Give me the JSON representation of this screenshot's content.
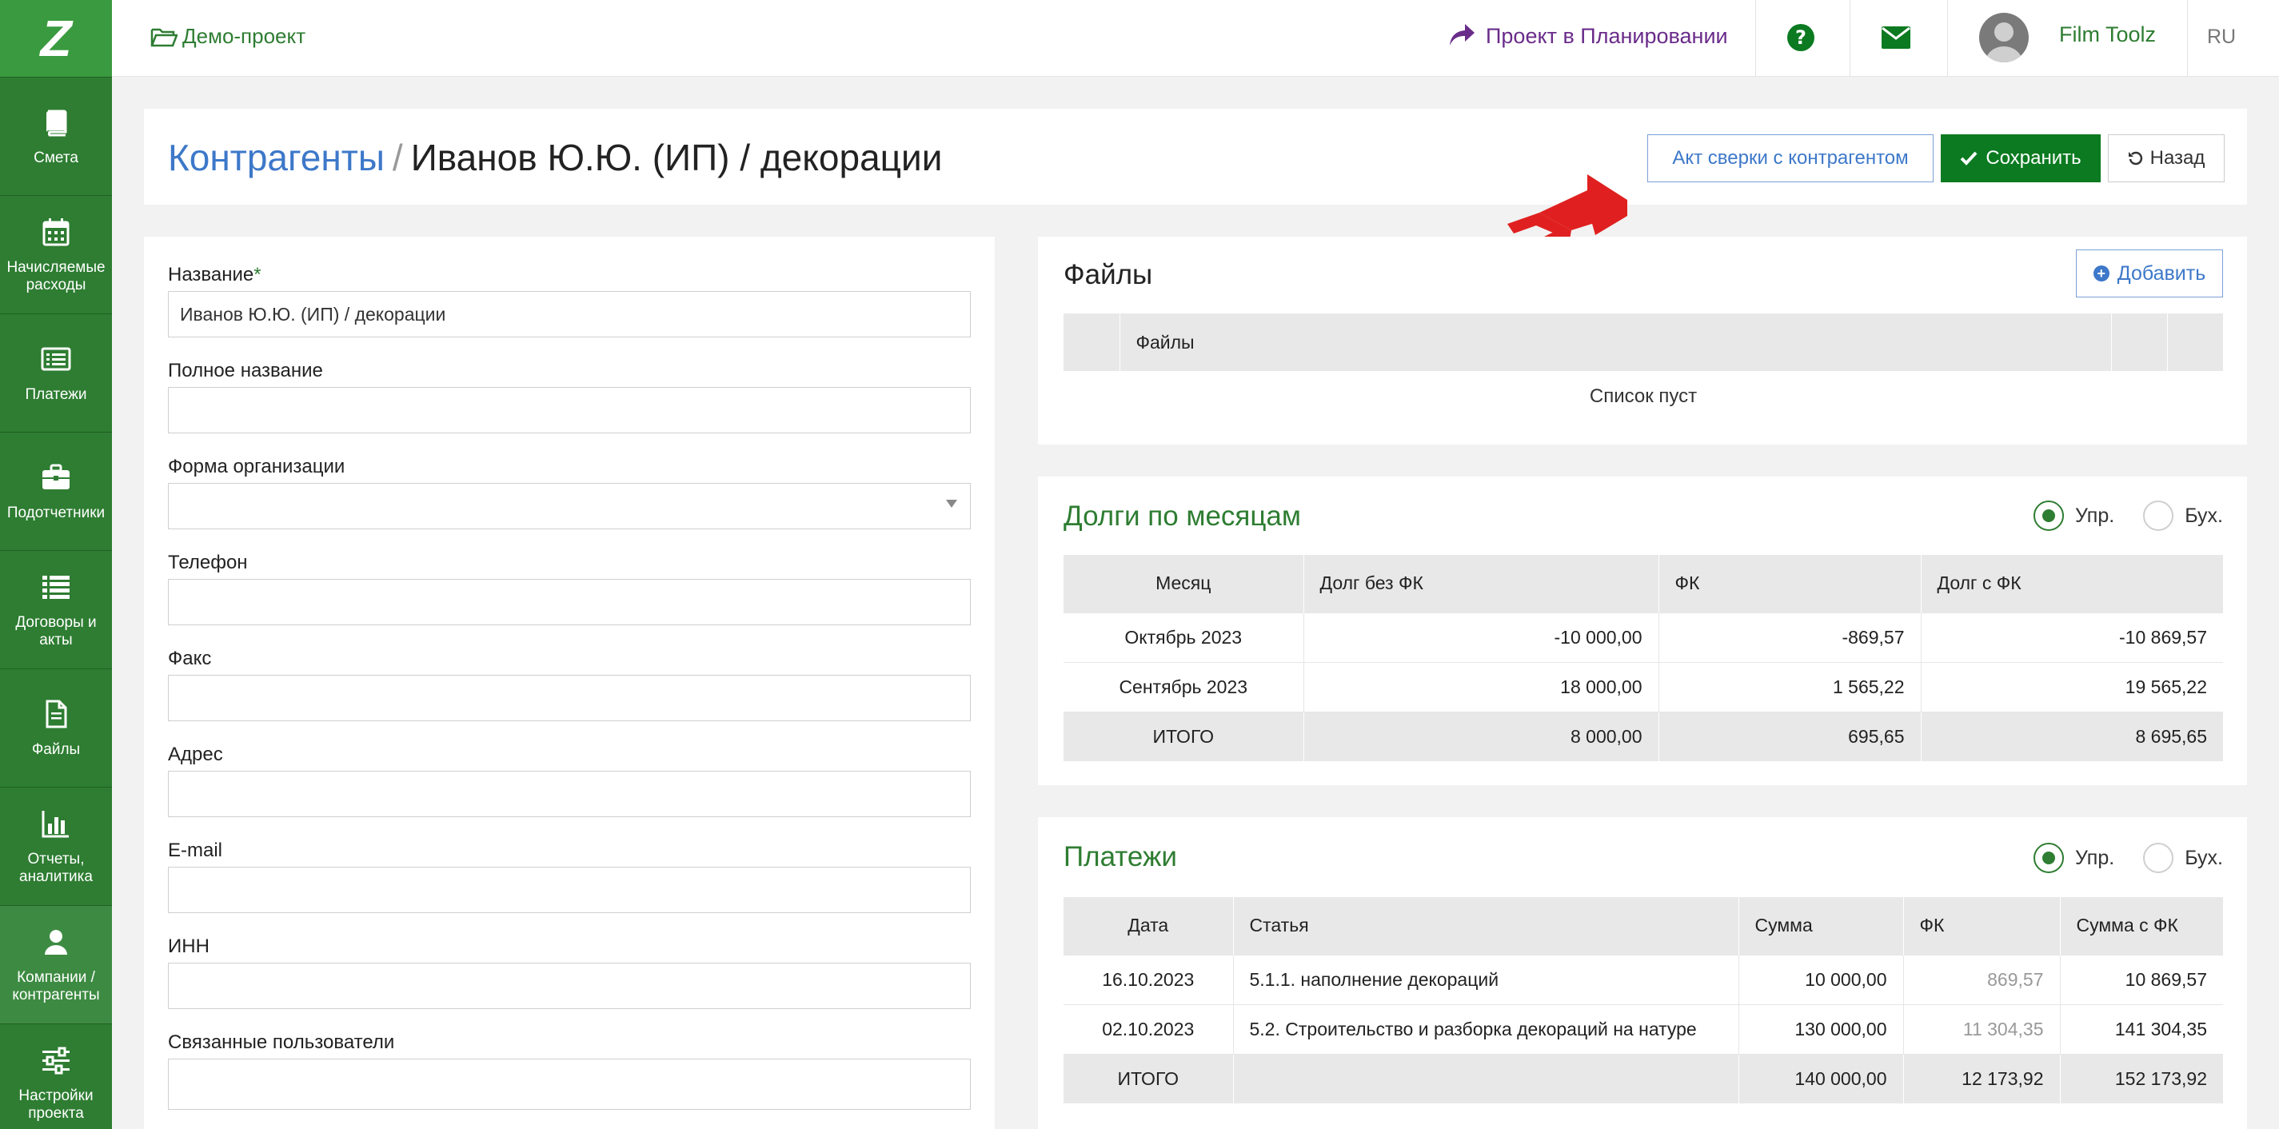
{
  "sidebar": {
    "logo": "Z",
    "items": [
      {
        "label": "Смета",
        "icon": "book-icon"
      },
      {
        "label": "Начисляемые расходы",
        "icon": "calendar-icon"
      },
      {
        "label": "Платежи",
        "icon": "list-card-icon"
      },
      {
        "label": "Подотчетники",
        "icon": "briefcase-icon"
      },
      {
        "label": "Договоры и акты",
        "icon": "bullet-list-icon"
      },
      {
        "label": "Файлы",
        "icon": "file-icon"
      },
      {
        "label": "Отчеты, аналитика",
        "icon": "bar-chart-icon"
      },
      {
        "label": "Компании / контрагенты",
        "icon": "user-icon",
        "active": true
      },
      {
        "label": "Настройки проекта",
        "icon": "sliders-icon"
      }
    ]
  },
  "topbar": {
    "project": "Демо-проект",
    "plan_status": "Проект в Планировании",
    "user_name": "Film Toolz",
    "lang": "RU"
  },
  "header": {
    "breadcrumb_root": "Контрагенты",
    "breadcrumb_sep": "/",
    "breadcrumb_current": "Иванов Ю.Ю. (ИП) / декорации",
    "act_button": "Акт сверки с контрагентом",
    "save_button": "Сохранить",
    "back_button": "Назад"
  },
  "form": {
    "name_label": "Название",
    "name_required": "*",
    "name_value": "Иванов Ю.Ю. (ИП) / декорации",
    "full_name_label": "Полное название",
    "org_form_label": "Форма организации",
    "phone_label": "Телефон",
    "fax_label": "Факс",
    "address_label": "Адрес",
    "email_label": "E-mail",
    "inn_label": "ИНН",
    "users_label": "Связанные пользователи"
  },
  "files": {
    "title": "Файлы",
    "add_button": "Добавить",
    "col_files": "Файлы",
    "empty": "Список пуст"
  },
  "debts": {
    "title": "Долги по месяцам",
    "radio_upr": "Упр.",
    "radio_buh": "Бух.",
    "headers": [
      "Месяц",
      "Долг без ФК",
      "ФК",
      "Долг с ФК"
    ],
    "rows": [
      [
        "Октябрь 2023",
        "-10 000,00",
        "-869,57",
        "-10 869,57"
      ],
      [
        "Сентябрь 2023",
        "18 000,00",
        "1 565,22",
        "19 565,22"
      ]
    ],
    "total": [
      "ИТОГО",
      "8 000,00",
      "695,65",
      "8 695,65"
    ]
  },
  "payments": {
    "title": "Платежи",
    "radio_upr": "Упр.",
    "radio_buh": "Бух.",
    "headers": [
      "Дата",
      "Статья",
      "Сумма",
      "ФК",
      "Сумма с ФК"
    ],
    "rows": [
      [
        "16.10.2023",
        "5.1.1. наполнение декораций",
        "10 000,00",
        "869,57",
        "10 869,57"
      ],
      [
        "02.10.2023",
        "5.2. Строительство и разборка декораций на натуре",
        "130 000,00",
        "11 304,35",
        "141 304,35"
      ]
    ],
    "total": [
      "ИТОГО",
      "",
      "140 000,00",
      "12 173,92",
      "152 173,92"
    ]
  },
  "colors": {
    "sidebar_green": "#2e7d32",
    "save_green": "#0b7a20",
    "link_blue": "#3d78c9",
    "plan_purple": "#6a2c8a",
    "logo_red": "#e02020"
  }
}
